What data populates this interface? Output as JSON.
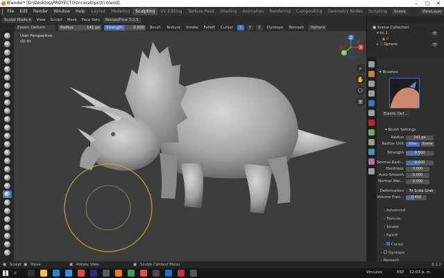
{
  "window": {
    "title": "Blender* [D:\\Desktop\\PROYECTO\\triceratops\\tri.blend]"
  },
  "menu": [
    "File",
    "Edit",
    "Render",
    "Window",
    "Help"
  ],
  "workspaces": [
    "Layout",
    "Modeling",
    "Sculpting",
    "UV Editing",
    "Texture Paint",
    "Shading",
    "Animation",
    "Rendering",
    "Compositing",
    "Geometry Nodes",
    "Scripting"
  ],
  "scene": {
    "name": "Scene",
    "view_layer": "ViewLayer"
  },
  "header": {
    "mode": "Sculpt Mode",
    "menus": [
      "View",
      "Sculpt",
      "Mask",
      "Face Sets"
    ],
    "remesh_preset": "RetopoFlow 3.2.5",
    "brush_name": "Elastic Deform",
    "radius_label": "Radius",
    "radius_value": "141 px",
    "strength_label": "Strength",
    "strength_value": "0.500",
    "strength_fraction": 0.5,
    "right_menus": [
      "Brush",
      "Texture",
      "Stroke",
      "Falloff",
      "Cursor"
    ],
    "xyz": [
      "X",
      "Y",
      "Z"
    ],
    "dyntopo": "Dyntopo",
    "remesh": "Remesh",
    "options": "Options"
  },
  "viewport": {
    "perspective": "User Perspective",
    "object": "(0) tri"
  },
  "gizmo": {
    "x": "X",
    "y": "Y",
    "z": "Z"
  },
  "outliner": {
    "title": "Scene Collection",
    "items": [
      "tri.1",
      "ó",
      "Sphere"
    ]
  },
  "properties": {
    "brushes_title": "Brushes",
    "brush_name": "Elastic Def...",
    "brush_settings_title": "Brush Settings",
    "radius_label": "Radius",
    "radius_value": "141 px",
    "radius_unit_label": "Radius Unit",
    "radius_unit_view": "View",
    "radius_unit_scene": "Scene",
    "strength_label": "Strength",
    "strength_value": "0.500",
    "normal_radius_label": "Normal Radi...",
    "normal_radius_value": "0.500",
    "hardness_label": "Hardness",
    "hardness_value": "0.000",
    "autosmooth_label": "Auto-Smooth",
    "autosmooth_value": "0.000",
    "normal_weight_label": "Normal Wei...",
    "normal_weight_value": "0.000",
    "deformation_label": "Deformation",
    "deformation_value": "Tri-Scale Grab",
    "volume_label": "Volume Pres...",
    "volume_value": "0.400",
    "subpanels": [
      "Advanced",
      "Texture",
      "Stroke",
      "Falloff",
      "Cursor"
    ],
    "dyntopo": "Dyntopo",
    "remesh": "Remesh"
  },
  "status": {
    "left": [
      "Sculpt",
      "Move",
      "Rotate View",
      "Sculpt Context Menu"
    ],
    "version": "3.1.2"
  },
  "taskbar": {
    "vinculos": "Vinculos",
    "lang": "ESP",
    "time": "12:03 p. m."
  },
  "colors": {
    "accent": "#4772b3",
    "brush_circle": "#b8a634",
    "header_bg": "#2b2b2b"
  }
}
